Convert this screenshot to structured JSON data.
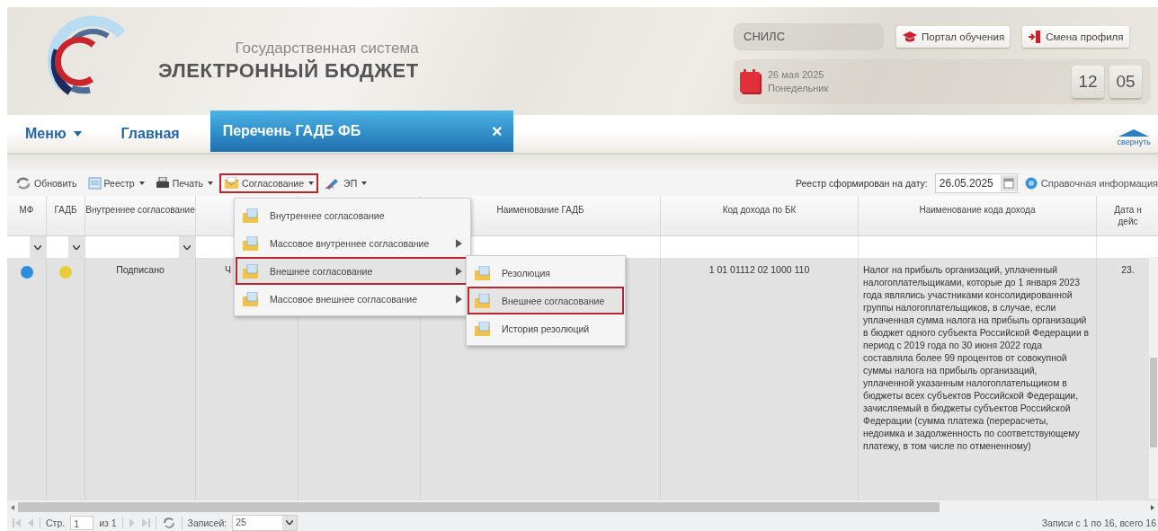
{
  "header": {
    "title_top": "Государственная система",
    "title_main": "ЭЛЕКТРОННЫЙ БЮДЖЕТ",
    "snils": "СНИЛС",
    "buttons": [
      {
        "label": "Портал обучения",
        "kind": "learning"
      },
      {
        "label": "Смена профиля",
        "kind": "profile"
      }
    ],
    "date": "26 мая 2025",
    "weekday": "Понедельник",
    "hours": "12",
    "minutes": "05"
  },
  "nav": {
    "menu": "Меню",
    "home": "Главная",
    "tabs": [
      {
        "label": "Перечень ГАДБ ФБ",
        "selected": true,
        "close": "×"
      }
    ],
    "collapse": "свернуть"
  },
  "toolbar": {
    "items": [
      {
        "label": "Обновить",
        "kind": "refresh",
        "dropdown": false,
        "highlighted": false
      },
      {
        "label": "Реестр",
        "kind": "registry",
        "dropdown": true,
        "highlighted": false
      },
      {
        "label": "Печать",
        "kind": "print",
        "dropdown": true,
        "highlighted": false
      },
      {
        "label": "Согласование",
        "kind": "approval",
        "dropdown": true,
        "highlighted": true
      },
      {
        "label": "ЭП",
        "kind": "signature",
        "dropdown": true,
        "highlighted": false
      }
    ],
    "date_label": "Реестр сформирован на дату:",
    "date_value": "26.05.2025",
    "help": "Справочная информация"
  },
  "table": {
    "columns": [
      {
        "label": "МФ",
        "filter": true
      },
      {
        "label": "ГАДБ",
        "filter": true
      },
      {
        "label": "Внутреннее согласование",
        "filter": true
      },
      {},
      {},
      {
        "label": "Наименование ГАДБ"
      },
      {
        "label": "Код дохода по БК"
      },
      {
        "label": "Наименование кода дохода"
      },
      {
        "label": "Дата н\nдейс"
      }
    ],
    "rows": [
      {
        "cells": [
          {
            "kind": "status",
            "color": "#2e8fd8"
          },
          {
            "kind": "status",
            "color": "#e9cc3c"
          },
          {
            "kind": "text",
            "text": "Подписано"
          },
          {
            "kind": "lefttext",
            "text": "Ч"
          },
          {
            "kind": "empty"
          },
          {
            "kind": "empty"
          },
          {
            "kind": "text",
            "text": "1 01 01112 02 1000 110"
          },
          {
            "kind": "longtext",
            "text": "Налог на прибыль организаций, уплаченный налогоплательщиками, которые до 1 января 2023 года являлись участниками консолидированной группы налогоплательщиков, в случае, если уплаченная сумма налога на прибыль организаций в бюджет одного субъекта Российской Федерации в период с 2019 года по 30 июня 2022 года составляла более 99 процентов от совокупной суммы налога на прибыль организаций, уплаченной указанным налогоплательщиком в бюджеты всех субъектов Российской Федерации, зачисляемый в бюджеты субъектов Российской Федерации (сумма платежа (перерасчеты, недоимка и задолженность по соответствующему платежу, в том числе по отмененному)"
          },
          {
            "kind": "text",
            "text": "23."
          }
        ]
      }
    ]
  },
  "menu": {
    "items": [
      {
        "label": "Внутреннее согласование",
        "submenu": false,
        "selected": false
      },
      {
        "label": "Массовое внутреннее согласование",
        "submenu": true,
        "selected": false
      },
      {
        "label": "Внешнее согласование",
        "submenu": true,
        "selected": true
      },
      {
        "label": "Массовое внешнее согласование",
        "submenu": true,
        "selected": false
      }
    ],
    "submenu": [
      {
        "label": "Резолюция",
        "selected": false
      },
      {
        "label": "Внешнее согласование",
        "selected": true
      },
      {
        "label": "История резолюций",
        "selected": false
      }
    ]
  },
  "pager": {
    "page_label": "Стр.",
    "page": "1",
    "of": "из 1",
    "records_label": "Записей:",
    "page_size": "25",
    "summary": "Записи с 1 по 16, всего 16"
  }
}
